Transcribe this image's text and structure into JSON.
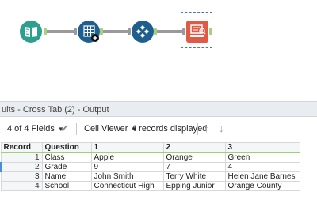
{
  "workflow": {
    "tools": [
      {
        "name": "input-data-tool",
        "color": "#2e9f8f"
      },
      {
        "name": "cross-tab-tool",
        "color": "#1f5f8f"
      },
      {
        "name": "union-tool",
        "color": "#1f5f8f"
      },
      {
        "name": "browse-tool",
        "color": "#e05a46"
      }
    ]
  },
  "results": {
    "title": "ults - Cross Tab (2) - Output",
    "fields_label": "4 of 4 Fields",
    "viewer_label": "Cell Viewer",
    "records_label": "4 records displayed",
    "icons": {
      "fields_dropdown": "chevron-down-icon",
      "apply": "checkmark-icon",
      "viewer_dropdown": "chevron-down-icon",
      "up": "arrow-up-icon",
      "down": "arrow-down-icon"
    },
    "columns": [
      "Record",
      "Question",
      "1",
      "2",
      "3"
    ],
    "rows": [
      [
        "1",
        "Class",
        "Apple",
        "Orange",
        "Green"
      ],
      [
        "2",
        "Grade",
        "9",
        "7",
        "4"
      ],
      [
        "3",
        "Name",
        "John Smith",
        "Terry White",
        "Helen Jane Barnes"
      ],
      [
        "4",
        "School",
        "Connecticut High",
        "Epping Junior",
        "Orange County"
      ]
    ]
  }
}
